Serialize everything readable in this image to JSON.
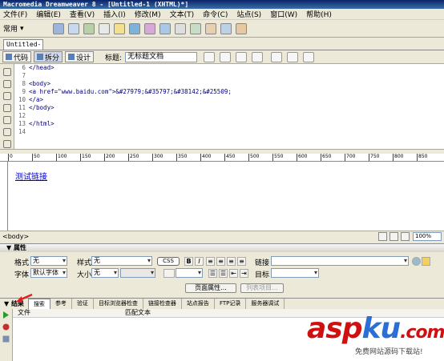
{
  "window": {
    "title": "Macromedia Dreamweaver 8 - [Untitled-1 (XHTML)*]"
  },
  "menu": [
    "文件(F)",
    "编辑(E)",
    "查看(V)",
    "插入(I)",
    "修改(M)",
    "文本(T)",
    "命令(C)",
    "站点(S)",
    "窗口(W)",
    "帮助(H)"
  ],
  "insertbar": {
    "category": "常用"
  },
  "document": {
    "tab": "Untitled-1*",
    "views": {
      "code": "代码",
      "split": "拆分",
      "design": "设计"
    },
    "title_label": "标题:",
    "title_value": "无标题文档"
  },
  "code": {
    "lines": [
      {
        "num": "6",
        "text": "</head>"
      },
      {
        "num": "7",
        "text": ""
      },
      {
        "num": "8",
        "text": "<body>"
      },
      {
        "num": "9",
        "text": "<a href=\"www.baidu.com\">&#27979;&#35797;&#38142;&#25509;"
      },
      {
        "num": "10",
        "text": "</a>"
      },
      {
        "num": "11",
        "text": "</body>"
      },
      {
        "num": "12",
        "text": ""
      },
      {
        "num": "13",
        "text": "</html>"
      },
      {
        "num": "14",
        "text": ""
      }
    ]
  },
  "ruler": {
    "marks": [
      "0",
      "50",
      "100",
      "150",
      "200",
      "250",
      "300",
      "350",
      "400",
      "450",
      "500",
      "550",
      "600",
      "650",
      "700",
      "750",
      "800",
      "850"
    ]
  },
  "design": {
    "link_text": "测试链接"
  },
  "status": {
    "tag": "<body>",
    "zoom": "100%"
  },
  "properties": {
    "header": "▼ 属性",
    "format_label": "格式",
    "format_value": "无",
    "font_label": "字体",
    "font_value": "默认字体",
    "style_label": "样式",
    "style_value": "无",
    "size_label": "大小",
    "size_value": "无",
    "css_label": "CSS",
    "bold": "B",
    "italic": "I",
    "link_label": "链接",
    "target_label": "目标",
    "page_props_button": "页面属性...",
    "list_item_button": "列表项目..."
  },
  "results": {
    "title": "▼ 结果",
    "tabs": [
      "搜索",
      "参考",
      "验证",
      "目标浏览器检查",
      "链接检查器",
      "站点报告",
      "FTP记录",
      "服务器调试"
    ],
    "col_file": "文件",
    "col_match": "匹配文本"
  },
  "watermark": {
    "logo_a": "asp",
    "logo_b": "ku",
    "logo_c": ".com",
    "tagline": "免费网站源码下载站!"
  },
  "colors": {
    "link": "#0000cc",
    "arrow": "#e02020",
    "logo_red": "#d01010",
    "logo_blue": "#2a6fd6"
  }
}
